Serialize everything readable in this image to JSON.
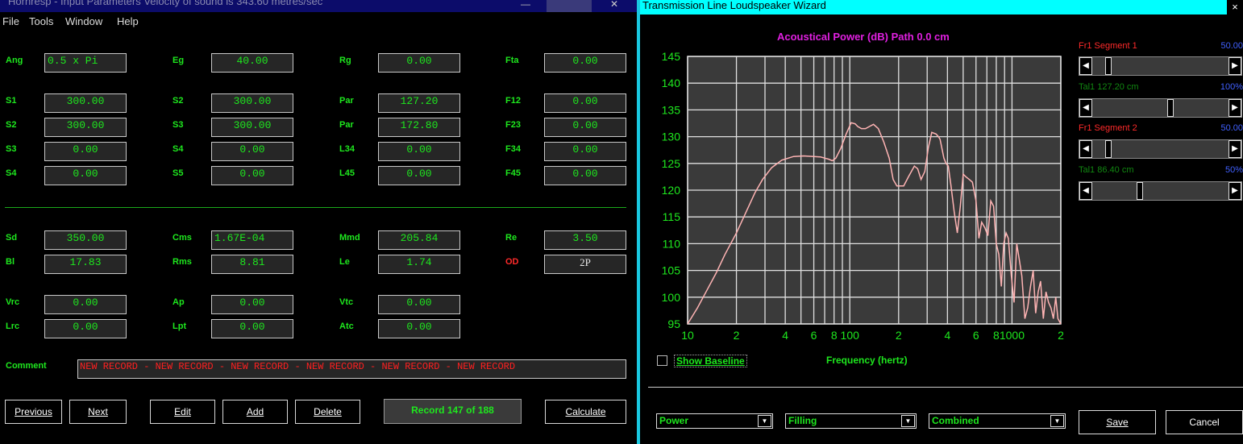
{
  "hornresp": {
    "title": "Hornresp - Input Parameters   Velocity of sound is 343.60 metres/sec",
    "menu": [
      "File",
      "Tools",
      "Window",
      "Help"
    ],
    "params": [
      {
        "label": "Ang",
        "value": "0.5 x Pi"
      },
      {
        "label": "Eg",
        "value": "40.00"
      },
      {
        "label": "Rg",
        "value": "0.00"
      },
      {
        "label": "Fta",
        "value": "0.00"
      },
      {
        "label": "S1",
        "value": "300.00"
      },
      {
        "label": "S2",
        "value": "300.00"
      },
      {
        "label": "Par",
        "value": "127.20"
      },
      {
        "label": "F12",
        "value": "0.00"
      },
      {
        "label": "S2",
        "value": "300.00"
      },
      {
        "label": "S3",
        "value": "300.00"
      },
      {
        "label": "Par",
        "value": "172.80"
      },
      {
        "label": "F23",
        "value": "0.00"
      },
      {
        "label": "S3",
        "value": "0.00"
      },
      {
        "label": "S4",
        "value": "0.00"
      },
      {
        "label": "L34",
        "value": "0.00"
      },
      {
        "label": "F34",
        "value": "0.00"
      },
      {
        "label": "S4",
        "value": "0.00"
      },
      {
        "label": "S5",
        "value": "0.00"
      },
      {
        "label": "L45",
        "value": "0.00"
      },
      {
        "label": "F45",
        "value": "0.00"
      },
      {
        "label": "Sd",
        "value": "350.00"
      },
      {
        "label": "Cms",
        "value": "1.67E-04"
      },
      {
        "label": "Mmd",
        "value": "205.84"
      },
      {
        "label": "Re",
        "value": "3.50"
      },
      {
        "label": "Bl",
        "value": "17.83"
      },
      {
        "label": "Rms",
        "value": "8.81"
      },
      {
        "label": "Le",
        "value": "1.74"
      },
      {
        "label": "OD",
        "value": "2P"
      },
      {
        "label": "Vrc",
        "value": "0.00"
      },
      {
        "label": "Ap",
        "value": "0.00"
      },
      {
        "label": "Vtc",
        "value": "0.00"
      },
      {
        "label": "Lrc",
        "value": "0.00"
      },
      {
        "label": "Lpt",
        "value": "0.00"
      },
      {
        "label": "Atc",
        "value": "0.00"
      }
    ],
    "comment_label": "Comment",
    "comment": "NEW RECORD - NEW RECORD - NEW RECORD - NEW RECORD - NEW RECORD - NEW RECORD",
    "buttons": {
      "previous": "Previous",
      "next": "Next",
      "edit": "Edit",
      "add": "Add",
      "delete": "Delete",
      "calculate": "Calculate"
    },
    "record": "Record 147 of 188"
  },
  "wizard": {
    "title": "Transmission Line Loudspeaker Wizard",
    "close": "×",
    "plot_title": "Acoustical Power (dB)   Path 0.0 cm",
    "show_baseline": "Show Baseline",
    "sliders": [
      {
        "label": "Fr1  Segment 1",
        "value": "50.00",
        "position": 0.1
      },
      {
        "label": "Tal1  127.20 cm",
        "value": "100%",
        "position": 0.58
      },
      {
        "label": "Fr1  Segment 2",
        "value": "50.00",
        "position": 0.1
      },
      {
        "label": "Tal1  86.40 cm",
        "value": "50%",
        "position": 0.34
      }
    ],
    "selects": [
      "Power",
      "Filling",
      "Combined"
    ],
    "buttons": {
      "save": "Save",
      "cancel": "Cancel"
    },
    "colors": {
      "title_bar": "#00ffff",
      "plot_title": "#e020e0",
      "curve": "#ffb4b4",
      "grid": "#e0e0e0",
      "labels": "#1ee81e"
    }
  },
  "chart_data": {
    "type": "line",
    "title": "Acoustical Power (dB)   Path 0.0 cm",
    "xlabel": "Frequency (hertz)",
    "ylabel": "",
    "xscale": "log",
    "xlim": [
      10,
      2000
    ],
    "ylim": [
      95,
      145
    ],
    "yticks": [
      "145",
      "140",
      "135",
      "130",
      "125",
      "120",
      "115",
      "110",
      "105",
      "100",
      "95"
    ],
    "xticks": [
      {
        "v": 10,
        "t": "10"
      },
      {
        "v": 20,
        "t": "2"
      },
      {
        "v": 40,
        "t": "4"
      },
      {
        "v": 60,
        "t": "6"
      },
      {
        "v": 80,
        "t": "8"
      },
      {
        "v": 100,
        "t": "100"
      },
      {
        "v": 200,
        "t": "2"
      },
      {
        "v": 400,
        "t": "4"
      },
      {
        "v": 600,
        "t": "6"
      },
      {
        "v": 800,
        "t": "8"
      },
      {
        "v": 1000,
        "t": "1000"
      },
      {
        "v": 2000,
        "t": "2"
      }
    ],
    "grid": true,
    "series": [
      {
        "x": [
          10,
          11.5,
          13,
          15,
          17,
          20,
          23,
          26,
          29,
          33,
          38,
          45,
          52,
          60,
          66,
          70,
          74,
          78,
          82,
          88,
          95,
          102,
          108,
          112,
          118,
          125,
          132,
          140,
          150,
          162,
          175,
          185,
          195,
          205,
          215,
          230,
          250,
          262,
          275,
          290,
          305,
          320,
          340,
          352,
          360,
          370,
          380,
          392,
          405,
          420,
          440,
          460,
          480,
          500,
          520,
          545,
          570,
          600,
          625,
          650,
          680,
          710,
          740,
          770,
          800,
          830,
          860,
          890,
          920,
          950,
          990,
          1030,
          1070,
          1110,
          1150,
          1200,
          1250,
          1300,
          1350,
          1400,
          1450,
          1500,
          1560,
          1620,
          1680,
          1740,
          1800,
          1860,
          1920,
          2000
        ],
        "y": [
          95,
          98,
          101,
          104.5,
          108,
          112,
          116,
          119.5,
          122,
          124.2,
          125.6,
          126.3,
          126.4,
          126.3,
          126.2,
          126,
          125.8,
          125.5,
          126,
          127.8,
          130.5,
          132.6,
          132.4,
          131.9,
          131.5,
          131.5,
          131.9,
          132.3,
          131.5,
          129,
          126,
          122,
          120.8,
          120.8,
          120.8,
          122.5,
          124.5,
          124,
          122,
          123.5,
          128,
          130.8,
          130.5,
          130,
          129.5,
          127.8,
          126,
          125,
          124.5,
          121,
          116,
          112,
          117,
          123,
          122.5,
          122,
          121.5,
          118,
          111,
          114,
          113,
          111.5,
          118,
          117,
          110,
          108,
          102,
          110,
          112,
          111,
          104,
          99,
          110,
          107,
          104,
          96,
          98,
          102,
          105,
          97,
          101,
          103,
          96,
          101,
          99,
          98,
          96,
          100,
          96,
          95
        ]
      }
    ]
  }
}
